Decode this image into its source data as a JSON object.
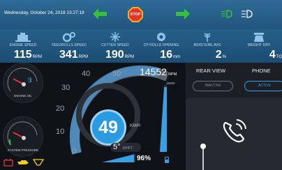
{
  "status_bar": {
    "datetime": "Wednesday, October 24, 2018 13:27:19",
    "stop_label": "STOP",
    "icons": [
      "left-arrow-icon",
      "stop-sign-icon",
      "right-arrow-icon",
      "headlight-icon",
      "parking-light-icon"
    ],
    "colors": {
      "arrow": "#35c13a",
      "stop": "#e8332b",
      "stop_border": "#f2b21a"
    }
  },
  "metrics": [
    {
      "label": "ENGINE SPEED",
      "value": "115",
      "unit": "RPM",
      "icon": "engine-icon"
    },
    {
      "label": "FEEDROLLS SPEED",
      "value": "341",
      "unit": "RPM",
      "icon": "gears-icon"
    },
    {
      "label": "CUTTER SPEED",
      "value": "190",
      "unit": "RPM",
      "icon": "cutter-icon"
    },
    {
      "label": "CP ROLLS OPENING",
      "value": "16",
      "unit": "mm",
      "icon": "rolls-icon"
    },
    {
      "label": "MOISTURE AVG",
      "value": "2",
      "unit": "%",
      "icon": "wheat-icon"
    },
    {
      "label": "WEIGHT DRY",
      "value": "4",
      "unit": "TO",
      "icon": "weight-icon"
    }
  ],
  "dashboard": {
    "engine_oil_label": "ENGINE OIL",
    "system_pressure_label": "SYSTEM PRESSURE",
    "speed_scale": [
      "0",
      "10",
      "20",
      "30",
      "40",
      "50"
    ],
    "speed_value": "49",
    "speed_unit": "KM/H",
    "rpm_value": "14552",
    "rpm_unit": "RPM",
    "rpm_max": "15000",
    "rpm_level": 0.97,
    "shift_value": "5°",
    "shift_label": "SHIFT",
    "fuel_value": "96%",
    "fuel_level": 0.96,
    "warning_icons": [
      "battery-warning-icon",
      "oil-warning-icon",
      "coolant-warning-icon"
    ]
  },
  "right_panel": {
    "rear_view_label": "REAR VIEW",
    "phone_label": "PHONE",
    "inactive_label": "INACTIVE",
    "active_label": "ACTIVE",
    "call_icon": "phone-call-icon"
  }
}
